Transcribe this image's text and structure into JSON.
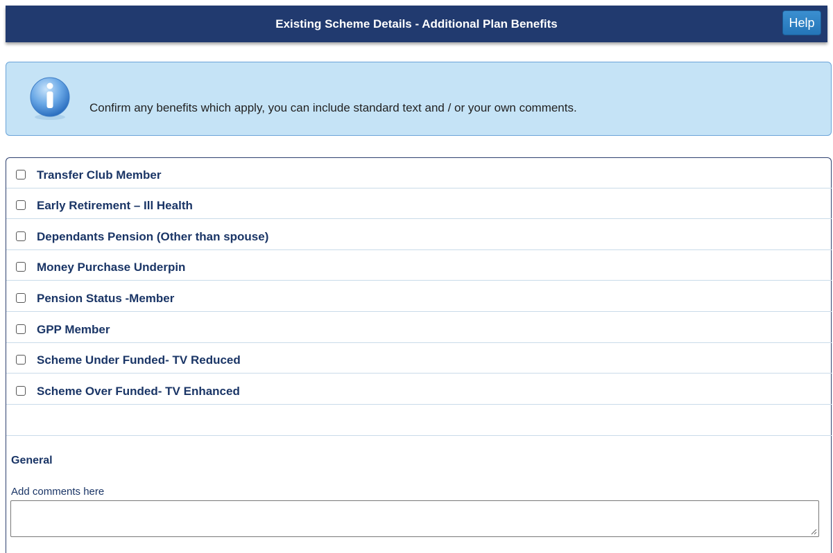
{
  "header": {
    "title": "Existing Scheme Details - Additional Plan Benefits",
    "help_label": "Help"
  },
  "info": {
    "icon": "info-icon",
    "message": "Confirm any benefits which apply, you can include standard text and / or your own comments."
  },
  "benefits": [
    {
      "label": "Transfer Club Member",
      "checked": false
    },
    {
      "label": "Early Retirement – Ill Health",
      "checked": false
    },
    {
      "label": "Dependants Pension (Other than spouse)",
      "checked": false
    },
    {
      "label": "Money Purchase Underpin",
      "checked": false
    },
    {
      "label": "Pension Status -Member",
      "checked": false
    },
    {
      "label": "GPP Member",
      "checked": false
    },
    {
      "label": "Scheme Under Funded- TV Reduced",
      "checked": false
    },
    {
      "label": "Scheme Over Funded- TV Enhanced",
      "checked": false
    }
  ],
  "general": {
    "title": "General",
    "comments_label": "Add comments here",
    "comments_value": ""
  },
  "colors": {
    "header_bg": "#213a6f",
    "info_bg": "#c5e3f6",
    "label_text": "#1a3566",
    "help_button": "#2a7dc0"
  }
}
